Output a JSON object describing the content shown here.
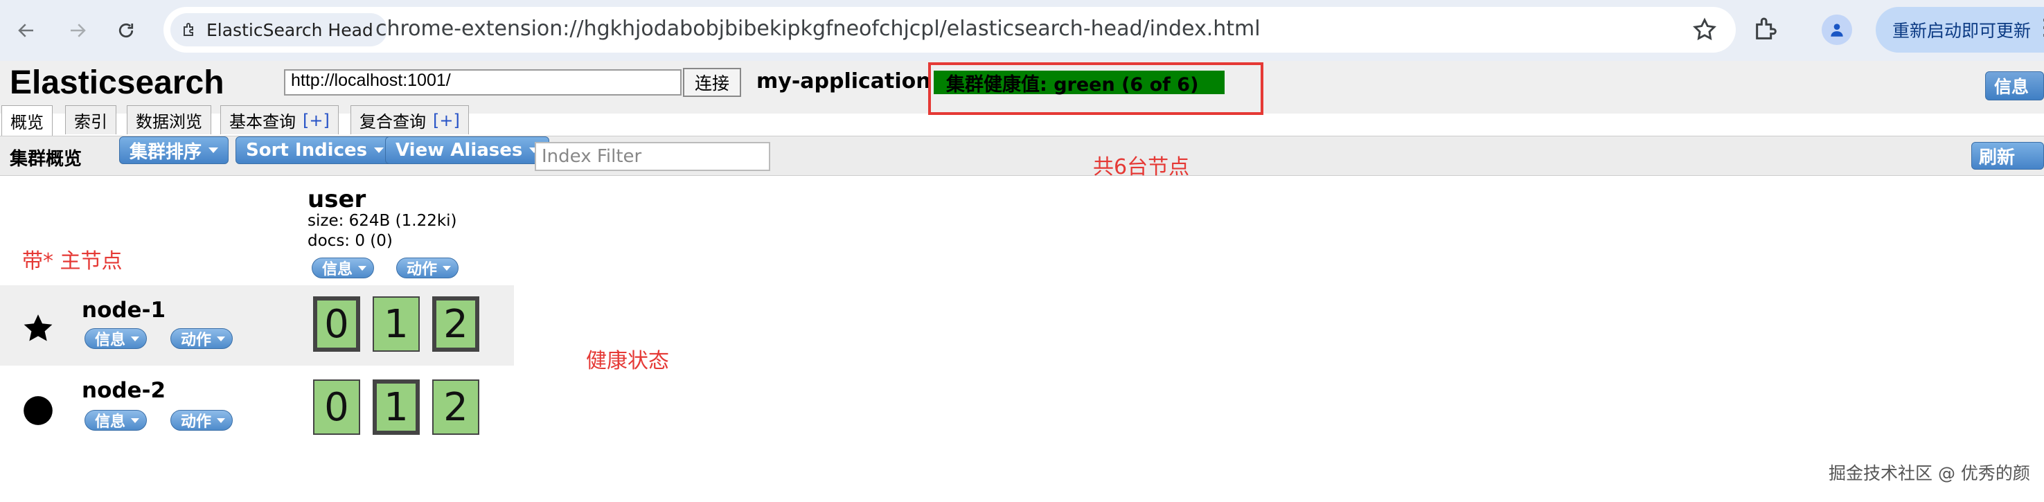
{
  "browser": {
    "tab_title": "ElasticSearch Head",
    "url": "chrome-extension://hgkhjodabobjbibekipkgfneofchjcpl/elasticsearch-head/index.html",
    "relaunch_label": "重新启动即可更新",
    "menu": "⋮"
  },
  "header": {
    "title": "Elasticsearch",
    "connect_url": "http://localhost:1001/",
    "connect_label": "连接",
    "cluster_name": "my-application",
    "health": "集群健康值: green (6 of 6)",
    "info_label": "信息"
  },
  "tabs": [
    {
      "label": "概览"
    },
    {
      "label": "索引"
    },
    {
      "label": "数据浏览"
    },
    {
      "label": "基本查询",
      "plus": "[+]"
    },
    {
      "label": "复合查询",
      "plus": "[+]"
    }
  ],
  "toolbar": {
    "title": "集群概览",
    "sort_cluster": "集群排序",
    "sort_indices": "Sort Indices",
    "view_aliases": "View Aliases",
    "filter_placeholder": "Index Filter",
    "refresh": "刷新"
  },
  "annotations": {
    "nodes_total": "共6台节点",
    "master_note": "带* 主节点",
    "health_state": "健康状态"
  },
  "index": {
    "name": "user",
    "size": "size: 624B (1.22ki)",
    "docs": "docs: 0 (0)",
    "info_label": "信息",
    "action_label": "动作"
  },
  "nodes": [
    {
      "name": "node-1",
      "icon": "star-icon",
      "info_label": "信息",
      "action_label": "动作",
      "shards": [
        {
          "id": "0",
          "primary": true
        },
        {
          "id": "1",
          "primary": false
        },
        {
          "id": "2",
          "primary": true
        }
      ]
    },
    {
      "name": "node-2",
      "icon": "circle-icon",
      "info_label": "信息",
      "action_label": "动作",
      "shards": [
        {
          "id": "0",
          "primary": false
        },
        {
          "id": "1",
          "primary": true
        },
        {
          "id": "2",
          "primary": false
        }
      ]
    }
  ],
  "watermark": "掘金技术社区 @ 优秀的颜",
  "colors": {
    "health_green": "#008000",
    "shard_green": "#98d080",
    "annotation_red": "#e53935"
  }
}
